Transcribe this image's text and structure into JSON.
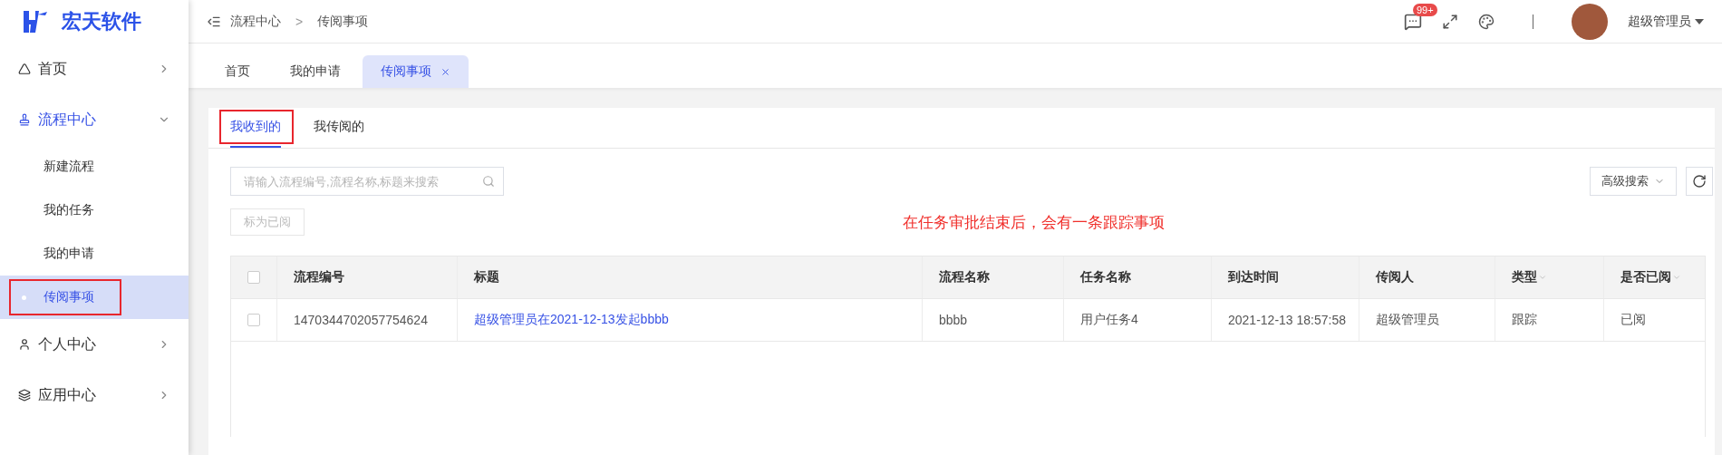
{
  "logo": {
    "text": "宏天软件"
  },
  "sidebar": {
    "items": [
      {
        "label": "首页",
        "expanded": false
      },
      {
        "label": "流程中心",
        "expanded": true,
        "children": [
          {
            "label": "新建流程",
            "selected": false,
            "highlighted": false
          },
          {
            "label": "我的任务",
            "selected": false,
            "highlighted": false
          },
          {
            "label": "我的申请",
            "selected": false,
            "highlighted": false
          },
          {
            "label": "传阅事项",
            "selected": true,
            "highlighted": true
          }
        ]
      },
      {
        "label": "个人中心",
        "expanded": false
      },
      {
        "label": "应用中心",
        "expanded": false
      }
    ]
  },
  "breadcrumb": [
    "流程中心",
    "传阅事项"
  ],
  "breadcrumb_separator": ">",
  "header": {
    "message_badge": "99+",
    "user": "超级管理员"
  },
  "page_tabs": [
    {
      "label": "首页",
      "selected": false,
      "closable": false
    },
    {
      "label": "我的申请",
      "selected": false,
      "closable": false
    },
    {
      "label": "传阅事项",
      "selected": true,
      "closable": true
    }
  ],
  "card_tabs": [
    {
      "label": "我收到的",
      "selected": true,
      "highlighted": true
    },
    {
      "label": "我传阅的",
      "selected": false,
      "highlighted": false
    }
  ],
  "search": {
    "placeholder": "请输入流程编号,流程名称,标题来搜索"
  },
  "advanced_search": "高级搜索",
  "mark_read_button": {
    "label": "标为已阅",
    "disabled": true
  },
  "annotation": "在任务审批结束后，会有一条跟踪事项",
  "table": {
    "all_checked": false,
    "columns": [
      {
        "label": "流程编号",
        "sortable": false
      },
      {
        "label": "标题",
        "sortable": false
      },
      {
        "label": "流程名称",
        "sortable": false
      },
      {
        "label": "任务名称",
        "sortable": false
      },
      {
        "label": "到达时间",
        "sortable": false
      },
      {
        "label": "传阅人",
        "sortable": false
      },
      {
        "label": "类型",
        "sortable": true
      },
      {
        "label": "是否已阅",
        "sortable": true
      }
    ],
    "rows": [
      {
        "checked": false,
        "cells": [
          "1470344702057754624",
          "超级管理员在2021-12-13发起bbbb",
          "bbbb",
          "用户任务4",
          "2021-12-13 18:57:58",
          "超级管理员",
          "跟踪",
          "已阅"
        ]
      }
    ]
  }
}
